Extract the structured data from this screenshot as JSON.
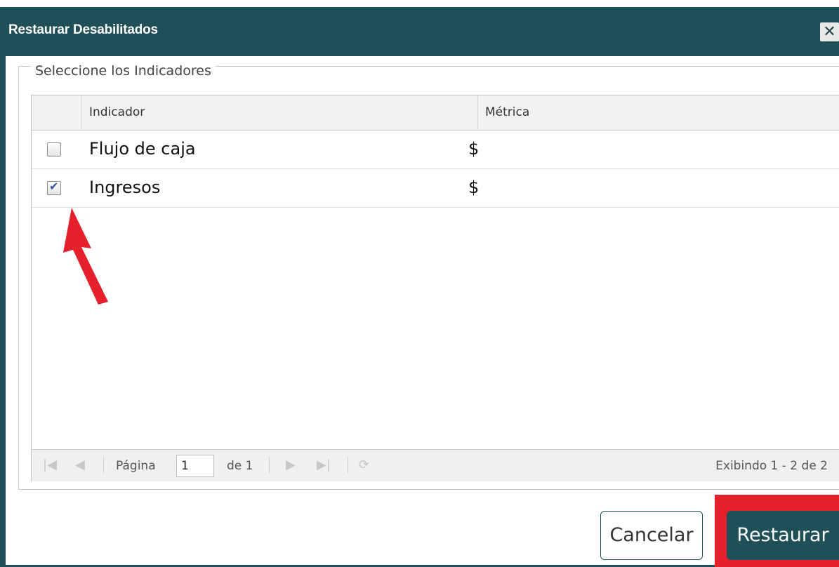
{
  "dialog": {
    "title": "Restaurar Desabilitados",
    "close_symbol": "✕",
    "fieldset_legend": "Seleccione los Indicadores"
  },
  "grid": {
    "columns": [
      "Indicador",
      "Métrica"
    ],
    "rows": [
      {
        "checked": false,
        "indicador": "Flujo de caja",
        "metrica": "$"
      },
      {
        "checked": true,
        "indicador": "Ingresos",
        "metrica": "$"
      }
    ]
  },
  "pager": {
    "page_label": "Página",
    "page_value": "1",
    "of_label": "de 1",
    "info": "Exibindo 1 - 2 de 2"
  },
  "buttons": {
    "cancel": "Cancelar",
    "restore": "Restaurar"
  },
  "colors": {
    "header": "#1f5058",
    "highlight": "#e6202a",
    "check": "#3553a8"
  },
  "icons": [
    "close-icon",
    "first-page-icon",
    "prev-page-icon",
    "next-page-icon",
    "last-page-icon",
    "refresh-icon",
    "annotation-arrow"
  ]
}
